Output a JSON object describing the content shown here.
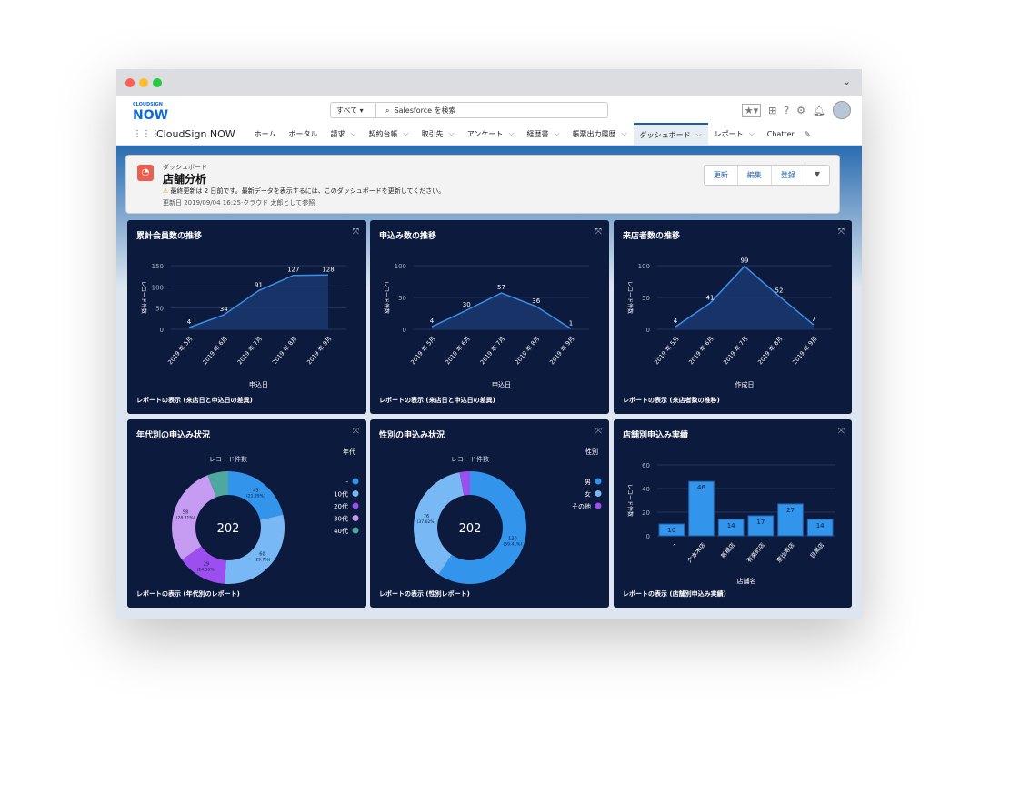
{
  "header": {
    "logo_small": "CLOUDSIGN",
    "logo_big": "NOW",
    "search_scope": "すべて",
    "search_placeholder": "Salesforce を検索",
    "app_name": "CloudSign NOW",
    "nav": [
      {
        "label": "ホーム",
        "dd": false
      },
      {
        "label": "ポータル",
        "dd": false
      },
      {
        "label": "請求",
        "dd": true
      },
      {
        "label": "契約台帳",
        "dd": true
      },
      {
        "label": "取引先",
        "dd": true
      },
      {
        "label": "アンケート",
        "dd": true
      },
      {
        "label": "経歴書",
        "dd": true
      },
      {
        "label": "帳票出力履歴",
        "dd": true
      },
      {
        "label": "ダッシュボード",
        "dd": true,
        "active": true
      },
      {
        "label": "レポート",
        "dd": true
      },
      {
        "label": "Chatter",
        "dd": false
      }
    ]
  },
  "dashboard": {
    "breadcrumb": "ダッシュボード",
    "title": "店舗分析",
    "warning": "最終更新は 2 日前です。最新データを表示するには、このダッシュボードを更新してください。",
    "meta": "更新日 2019/09/04 16:25·クラウド 太郎として参照",
    "buttons": [
      "更新",
      "編集",
      "登録"
    ]
  },
  "colors": {
    "dash_bg": "#0c1a3d",
    "line": "#3b8fe8",
    "bar": "#3394ec"
  },
  "chart_data": [
    {
      "type": "area",
      "title": "累計会員数の推移",
      "ylabel": "レコード件数",
      "xlabel": "申込日",
      "ylim": [
        0,
        150
      ],
      "yticks": [
        0,
        50,
        100,
        150
      ],
      "categories": [
        "2019 年 5月",
        "2019 年 6月",
        "2019 年 7月",
        "2019 年 8月",
        "2019 年 9月"
      ],
      "values": [
        4,
        34,
        91,
        127,
        128
      ],
      "footer": "レポートの表示 (来店日と申込日の差異)"
    },
    {
      "type": "area",
      "title": "申込み数の推移",
      "ylabel": "レコード件数",
      "xlabel": "申込日",
      "ylim": [
        0,
        100
      ],
      "yticks": [
        0,
        50,
        100
      ],
      "categories": [
        "2019 年 5月",
        "2019 年 6月",
        "2019 年 7月",
        "2019 年 8月",
        "2019 年 9月"
      ],
      "values": [
        4,
        30,
        57,
        36,
        1
      ],
      "footer": "レポートの表示 (来店日と申込日の差異)"
    },
    {
      "type": "area",
      "title": "来店者数の推移",
      "ylabel": "レコード件数",
      "xlabel": "作成日",
      "ylim": [
        0,
        100
      ],
      "yticks": [
        0,
        50,
        100
      ],
      "categories": [
        "2019 年 5月",
        "2019 年 6月",
        "2019 年 7月",
        "2019 年 8月",
        "2019 年 9月"
      ],
      "values": [
        4,
        41,
        99,
        52,
        7
      ],
      "footer": "レポートの表示 (来店者数の推移)"
    },
    {
      "type": "pie",
      "title": "年代別の申込み状況",
      "subtitle": "レコード件数",
      "total": "202",
      "legend_title": "年代",
      "legend": "right",
      "slices": [
        {
          "label": "-",
          "value": 43,
          "pct": "21.29%",
          "color": "#3394ec"
        },
        {
          "label": "10代",
          "value": 60,
          "pct": "29.7%",
          "color": "#78b9f5"
        },
        {
          "label": "20代",
          "value": 29,
          "pct": "14.36%",
          "color": "#9d4eef"
        },
        {
          "label": "30代",
          "value": 58,
          "pct": "28.71%",
          "color": "#c69cf2"
        },
        {
          "label": "40代",
          "value": 12,
          "pct": "",
          "color": "#4ea89f"
        }
      ],
      "footer": "レポートの表示 (年代別のレポート)"
    },
    {
      "type": "pie",
      "title": "性別の申込み状況",
      "subtitle": "レコード件数",
      "total": "202",
      "legend_title": "性別",
      "legend": "right",
      "slices": [
        {
          "label": "男",
          "value": 120,
          "pct": "59.41%",
          "color": "#3394ec"
        },
        {
          "label": "女",
          "value": 76,
          "pct": "37.62%",
          "color": "#78b9f5"
        },
        {
          "label": "その他",
          "value": 6,
          "pct": "",
          "color": "#9d4eef"
        }
      ],
      "footer": "レポートの表示 (性別レポート)"
    },
    {
      "type": "bar",
      "title": "店舗別申込み実績",
      "ylabel": "レコード件数",
      "xlabel": "店舗名",
      "ylim": [
        0,
        60
      ],
      "yticks": [
        0,
        20,
        40,
        60
      ],
      "categories": [
        "-",
        "六本木店",
        "新橋店",
        "有楽町店",
        "恵比寿店",
        "目黒店"
      ],
      "values": [
        10,
        46,
        14,
        17,
        27,
        14
      ],
      "footer": "レポートの表示 (店舗別申込み実績)"
    }
  ]
}
